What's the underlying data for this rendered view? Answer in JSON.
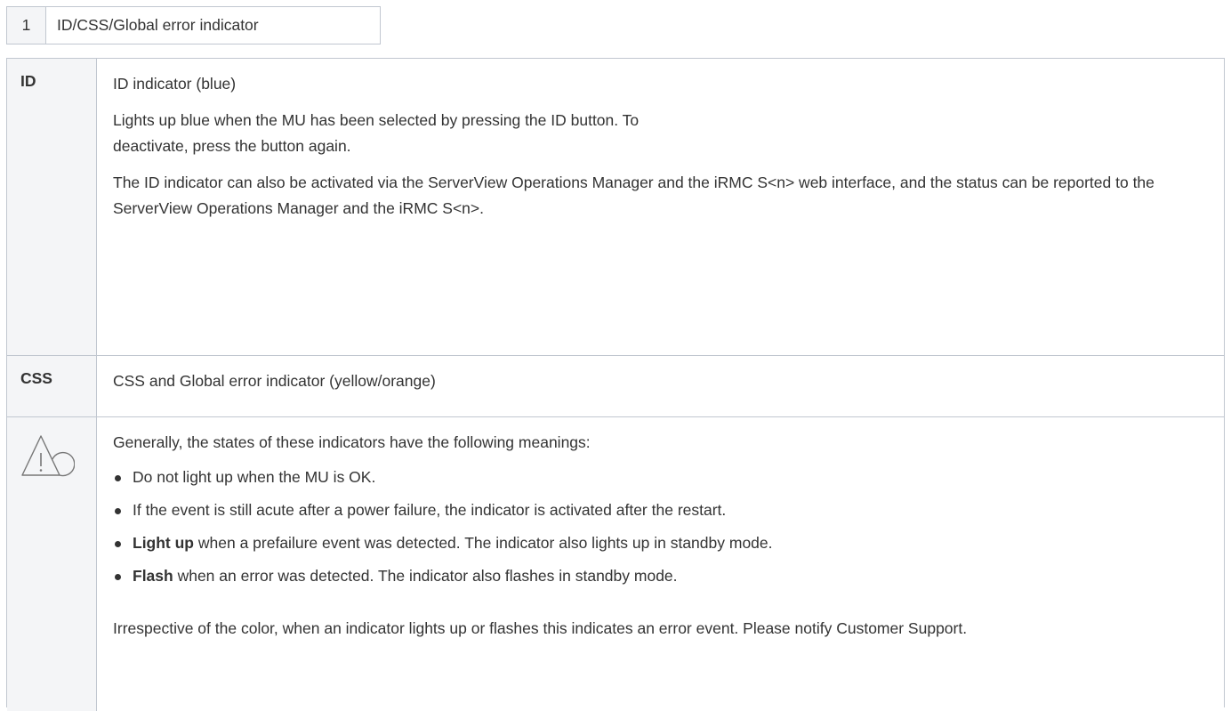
{
  "legend": {
    "number": "1",
    "label": "ID/CSS/Global error indicator"
  },
  "rows": {
    "id": {
      "key": "ID",
      "heading": "ID indicator (blue)",
      "para1_line1": "Lights up blue when the MU has been selected by pressing the ID button. To",
      "para1_line2": "deactivate, press the button again.",
      "para2": "The ID indicator can also be activated via the ServerView Operations Manager and the iRMC S<n> web interface, and the status can be reported to the ServerView Operations Manager and the iRMC S<n>."
    },
    "css": {
      "key": "CSS",
      "heading": "CSS and Global error indicator (yellow/orange)"
    },
    "meanings": {
      "icon": "caution-triangle-icon",
      "intro": "Generally, the states of these indicators have the following meanings:",
      "bullet1": "Do not light up when the MU is OK.",
      "bullet2": "If the event is still acute after a power failure, the indicator is activated after the restart.",
      "bullet3_bold": "Light up",
      "bullet3_rest": " when a prefailure event was detected. The indicator also lights up in standby mode.",
      "bullet4_bold": "Flash",
      "bullet4_rest": " when an error was detected. The indicator also flashes in standby mode.",
      "closing": "Irrespective of the color, when an indicator lights up or flashes this indicates an error event. Please notify Customer Support."
    }
  }
}
